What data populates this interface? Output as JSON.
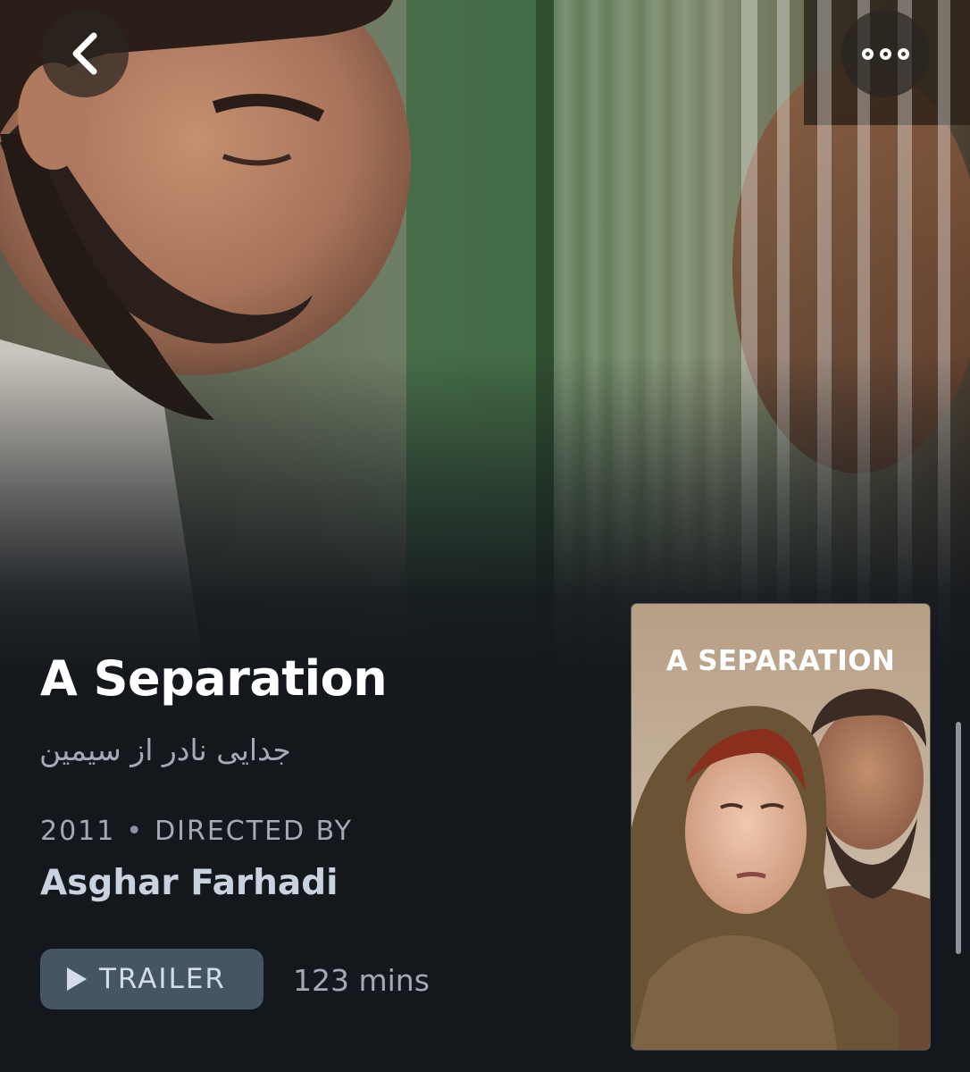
{
  "nav": {
    "back_icon": "chevron-left-icon",
    "more_icon": "more-horizontal-icon"
  },
  "film": {
    "title": "A Separation",
    "original_title": "جدایی نادر از سیمین",
    "year": "2011",
    "separator": "•",
    "directed_by_label": "DIRECTED BY",
    "director": "Asghar Farhadi",
    "runtime": "123 mins"
  },
  "trailer": {
    "label": "TRAILER",
    "icon": "play-icon"
  },
  "poster": {
    "title": "A SEPARATION"
  },
  "colors": {
    "background": "#14181d",
    "muted_text": "#a3aab6",
    "director_text": "#c9d3df",
    "trailer_button": "#465564"
  }
}
